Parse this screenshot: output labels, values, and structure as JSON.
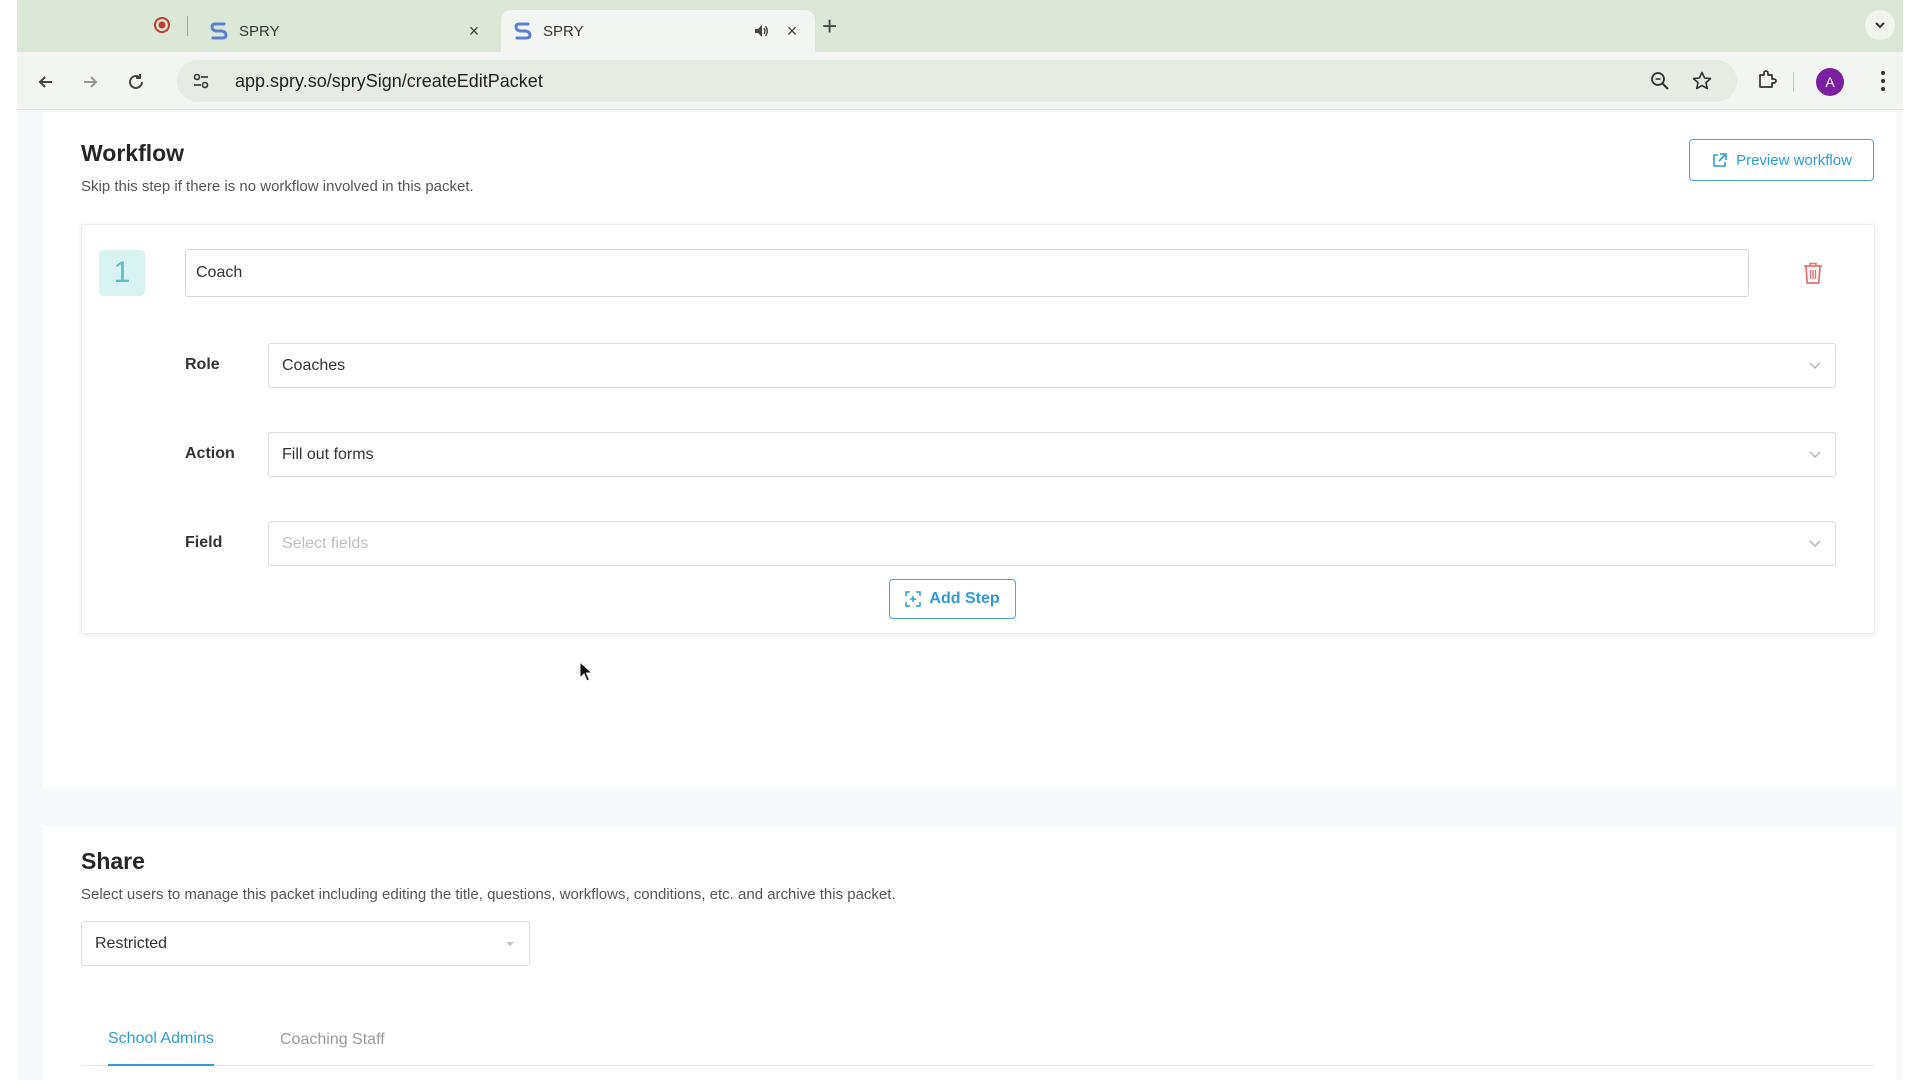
{
  "browser": {
    "tabs": [
      {
        "title": "SPRY",
        "active": false
      },
      {
        "title": "SPRY",
        "active": true
      }
    ],
    "url": "app.spry.so/sprySign/createEditPacket",
    "avatar_letter": "A",
    "icons": {
      "record": "record-icon",
      "close": "close-icon",
      "speaker": "speaker-icon",
      "new_tab": "plus-icon",
      "back": "back-arrow-icon",
      "forward": "forward-arrow-icon",
      "reload": "reload-icon",
      "site_settings": "tune-icon",
      "zoom": "magnifier-icon",
      "bookmark": "star-icon",
      "extensions": "puzzle-icon",
      "menu": "kebab-icon"
    }
  },
  "workflow": {
    "title": "Workflow",
    "subtitle": "Skip this step if there is no workflow involved in this packet.",
    "preview_label": "Preview workflow",
    "steps": [
      {
        "number": "1",
        "name": "Coach",
        "role_label": "Role",
        "role_value": "Coaches",
        "action_label": "Action",
        "action_value": "Fill out forms",
        "field_label": "Field",
        "field_placeholder": "Select fields"
      }
    ],
    "add_step_label": "Add Step"
  },
  "share": {
    "title": "Share",
    "subtitle": "Select users to manage this packet including editing the title, questions, workflows, conditions, etc. and archive this packet.",
    "access_value": "Restricted",
    "tabs": [
      {
        "label": "School Admins",
        "active": true
      },
      {
        "label": "Coaching Staff",
        "active": false
      }
    ]
  },
  "colors": {
    "accent": "#2e9bd6",
    "step_badge_bg": "#d9f2f2",
    "step_badge_fg": "#58c0c8",
    "trash": "#e57373",
    "tabstrip": "#dce8d7",
    "avatar": "#7b1fa2"
  }
}
